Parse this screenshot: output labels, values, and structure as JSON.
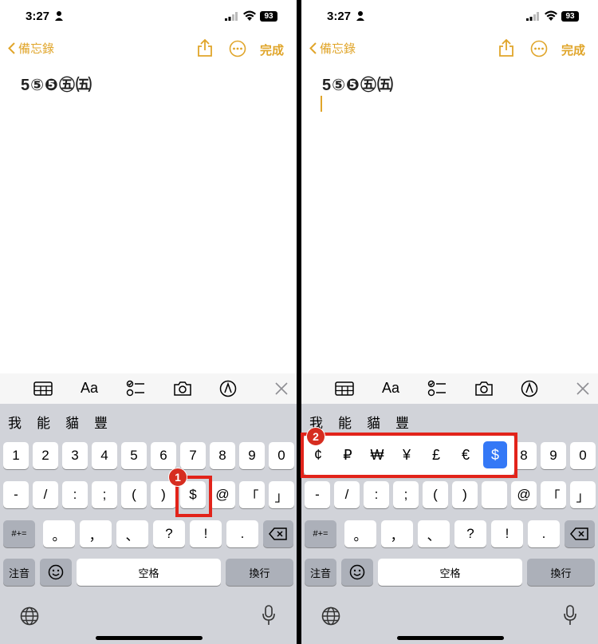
{
  "status": {
    "time": "3:27",
    "battery": "93"
  },
  "nav": {
    "back_label": "備忘錄",
    "done_label": "完成"
  },
  "note": {
    "text": "5⑤❺㊄㈤"
  },
  "toolbar": {
    "format_label": "Aa",
    "icons": [
      "table-icon",
      "format-icon",
      "checklist-icon",
      "camera-icon",
      "markup-icon",
      "close-icon"
    ]
  },
  "candidates": [
    "我",
    "能",
    "貓",
    "豐"
  ],
  "keys": {
    "row1": [
      "1",
      "2",
      "3",
      "4",
      "5",
      "6",
      "7",
      "8",
      "9",
      "0"
    ],
    "row2": [
      "-",
      "/",
      ":",
      ";",
      "(",
      ")",
      "$",
      "@",
      "「",
      "」"
    ],
    "row3": [
      "#+=",
      "。",
      "，",
      "、",
      "?",
      "!",
      "."
    ],
    "row4": {
      "mode": "注音",
      "space": "空格",
      "return": "換行"
    }
  },
  "currency_popup": [
    "¢",
    "₽",
    "₩",
    "¥",
    "£",
    "€",
    "$"
  ],
  "annotations": {
    "step1": "1",
    "step2": "2"
  },
  "colors": {
    "accent": "#e0a52a",
    "highlight": "#3478f6",
    "annotation": "#e2231a"
  }
}
